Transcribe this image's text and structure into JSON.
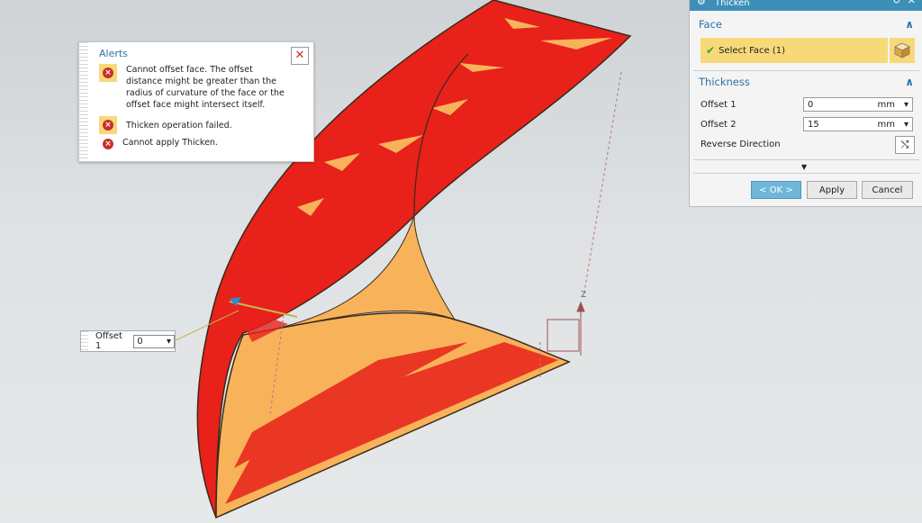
{
  "alerts": {
    "title": "Alerts",
    "close_icon": "close-icon",
    "messages": [
      {
        "text": "Cannot offset face. The offset distance might be greater than the radius of curvature of the face or the offset face might intersect itself.",
        "icon": "error-icon"
      },
      {
        "text": "Thicken operation failed.",
        "icon": "error-icon"
      },
      {
        "text": "Cannot apply Thicken.",
        "icon": "error-icon"
      }
    ]
  },
  "offset_popup": {
    "label": "Offset 1",
    "value": "0"
  },
  "dialog": {
    "title": "Thicken",
    "face_section": {
      "heading": "Face",
      "select_label": "Select Face (1)"
    },
    "thickness_section": {
      "heading": "Thickness",
      "offset1_label": "Offset 1",
      "offset1_value": "0",
      "offset1_unit": "mm",
      "offset2_label": "Offset 2",
      "offset2_value": "15",
      "offset2_unit": "mm",
      "reverse_label": "Reverse Direction"
    },
    "buttons": {
      "ok": "< OK >",
      "apply": "Apply",
      "cancel": "Cancel"
    }
  },
  "viewport": {
    "axis_label": "Z",
    "colors": {
      "outer_face": "#e8211b",
      "inner_face": "#f8b35a",
      "edge": "#3a2a1a"
    }
  }
}
